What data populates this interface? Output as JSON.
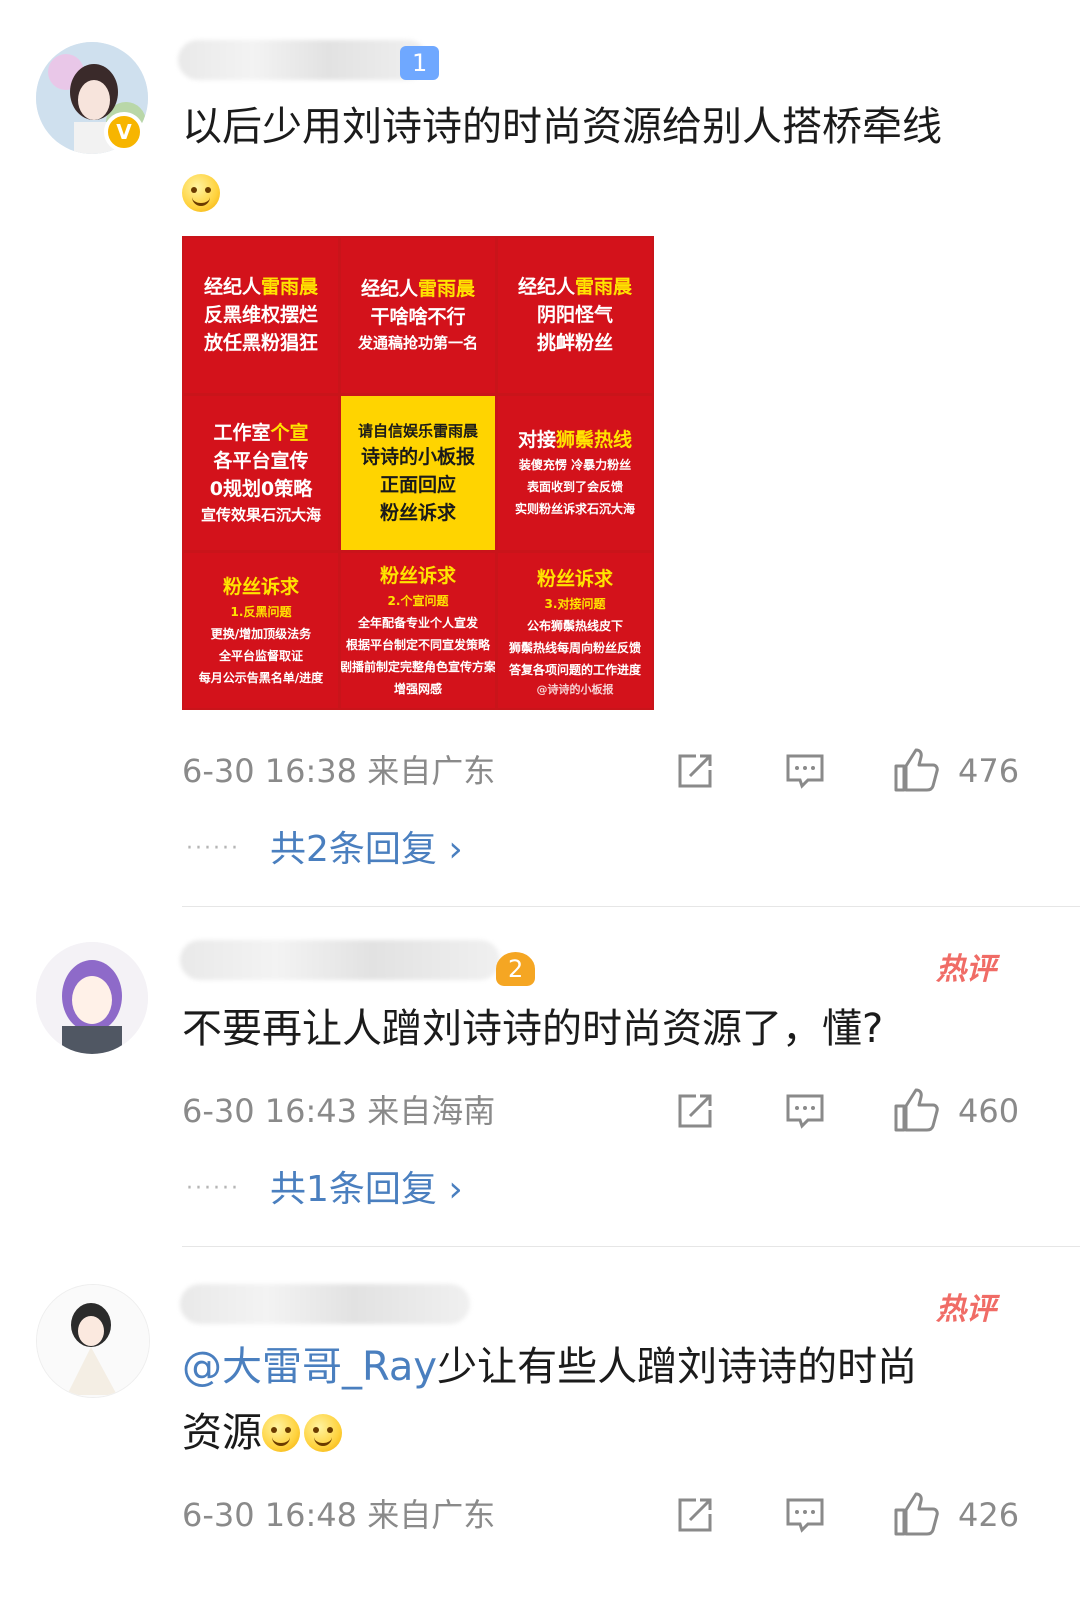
{
  "comments": [
    {
      "badge": "1",
      "text": "以后少用刘诗诗的时尚资源给别人搭桥牵线",
      "time": "6-30 16:38",
      "location": "来自广东",
      "likes": "476",
      "replies": "共2条回复",
      "verified": "V"
    },
    {
      "badge": "2",
      "hot": "热评",
      "text": "不要再让人蹭刘诗诗的时尚资源了，懂?",
      "time": "6-30 16:43",
      "location": "来自海南",
      "likes": "460",
      "replies": "共1条回复"
    },
    {
      "hot": "热评",
      "mention": "@大雷哥_Ray",
      "text": "少让有些人蹭刘诗诗的时尚",
      "text2": "资源",
      "time": "6-30 16:48",
      "location": "来自广东",
      "likes": "426"
    }
  ],
  "poster": {
    "cells": [
      {
        "l1a": "经纪人",
        "l1b": "雷雨晨",
        "l2": "反黑维权摆烂",
        "l3": "放任黑粉猖狂"
      },
      {
        "l1a": "经纪人",
        "l1b": "雷雨晨",
        "l2": "干啥啥不行",
        "l3": "发通稿抢功第一名"
      },
      {
        "l1a": "经纪人",
        "l1b": "雷雨晨",
        "l2": "阴阳怪气",
        "l3": "挑衅粉丝"
      },
      {
        "l1a": "工作室",
        "l1b": "个宣",
        "l2": "各平台宣传",
        "l3": "0规划0策略",
        "l4": "宣传效果石沉大海"
      },
      {
        "l1": "请自信娱乐雷雨晨",
        "l2": "诗诗的小板报",
        "l3": "正面回应",
        "l4": "粉丝诉求"
      },
      {
        "l1a": "对接",
        "l1b": "狮鬃热线",
        "l2": "装傻充愣 冷暴力粉丝",
        "l3": "表面收到了会反馈",
        "l4": "实则粉丝诉求石沉大海"
      },
      {
        "l1": "粉丝诉求",
        "l2": "1.反黑问题",
        "l3": "更换/增加顶级法务",
        "l4": "全平台监督取证",
        "l5": "每月公示告黑名单/进度"
      },
      {
        "l1": "粉丝诉求",
        "l2": "2.个宣问题",
        "l3": "全年配备专业个人宣发",
        "l4": "根据平台制定不同宣发策略",
        "l5": "剧播前制定完整角色宣传方案",
        "l6": "增强网感"
      },
      {
        "l1": "粉丝诉求",
        "l2": "3.对接问题",
        "l3": "公布狮鬃热线皮下",
        "l4": "狮鬃热线每周向粉丝反馈",
        "l5": "答复各项问题的工作进度",
        "wm": "@诗诗的小板报"
      }
    ]
  },
  "colors": {
    "mention": "#4a7fbf",
    "hot": "#f06c66",
    "poster_red": "#d3121b",
    "poster_yellow": "#ffd400"
  }
}
